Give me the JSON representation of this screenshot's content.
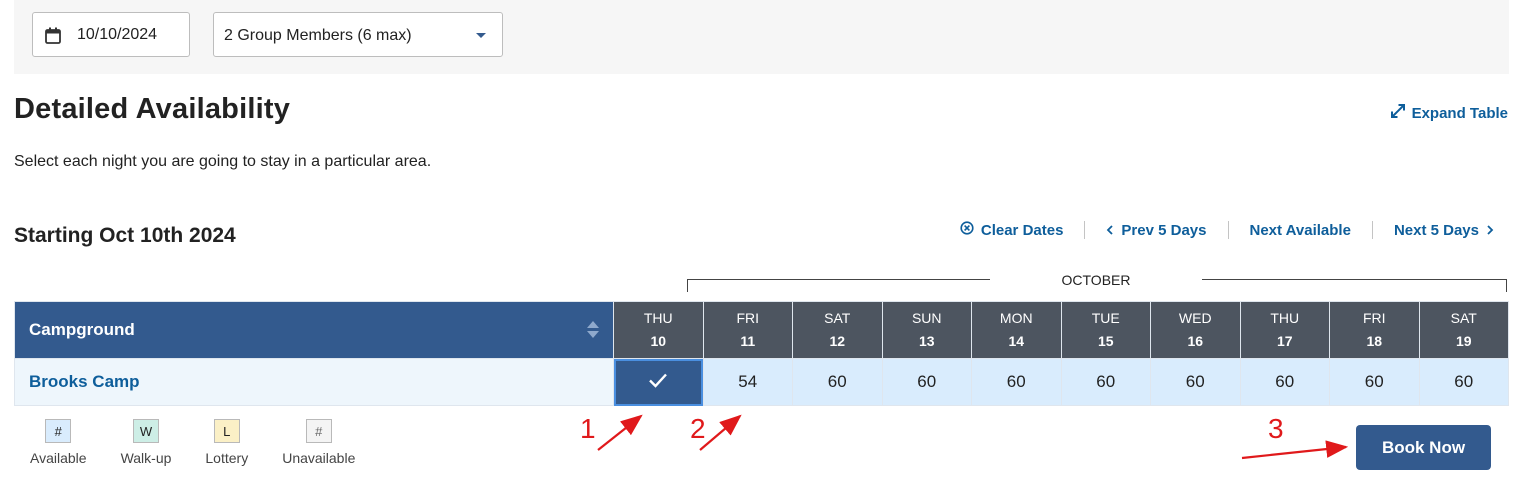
{
  "filters": {
    "date": "10/10/2024",
    "group": "2 Group Members (6 max)"
  },
  "header": {
    "title": "Detailed Availability",
    "expand_label": "Expand Table",
    "subtitle": "Select each night you are going to stay in a particular area."
  },
  "range": {
    "starting": "Starting Oct 10th 2024",
    "clear_dates": "Clear Dates",
    "prev": "Prev 5 Days",
    "next_available": "Next Available",
    "next": "Next 5 Days"
  },
  "table": {
    "month": "OCTOBER",
    "campground_header": "Campground",
    "days": [
      {
        "dow": "THU",
        "num": "10"
      },
      {
        "dow": "FRI",
        "num": "11"
      },
      {
        "dow": "SAT",
        "num": "12"
      },
      {
        "dow": "SUN",
        "num": "13"
      },
      {
        "dow": "MON",
        "num": "14"
      },
      {
        "dow": "TUE",
        "num": "15"
      },
      {
        "dow": "WED",
        "num": "16"
      },
      {
        "dow": "THU",
        "num": "17"
      },
      {
        "dow": "FRI",
        "num": "18"
      },
      {
        "dow": "SAT",
        "num": "19"
      }
    ],
    "rows": [
      {
        "name": "Brooks Camp",
        "cells": [
          "✓",
          "54",
          "60",
          "60",
          "60",
          "60",
          "60",
          "60",
          "60",
          "60"
        ]
      }
    ]
  },
  "legend": [
    {
      "symbol": "#",
      "label": "Available",
      "color": "#d9ecfd"
    },
    {
      "symbol": "W",
      "label": "Walk-up",
      "color": "#cdeee6"
    },
    {
      "symbol": "L",
      "label": "Lottery",
      "color": "#fbf0c6"
    },
    {
      "symbol": "#",
      "label": "Unavailable",
      "color": "#f4f4f4"
    }
  ],
  "book_now": "Book Now",
  "annotations": {
    "a1": "1",
    "a2": "2",
    "a3": "3"
  },
  "colors": {
    "primary": "#335a8e",
    "link": "#0e5e9b",
    "annotation": "#e0191b"
  }
}
